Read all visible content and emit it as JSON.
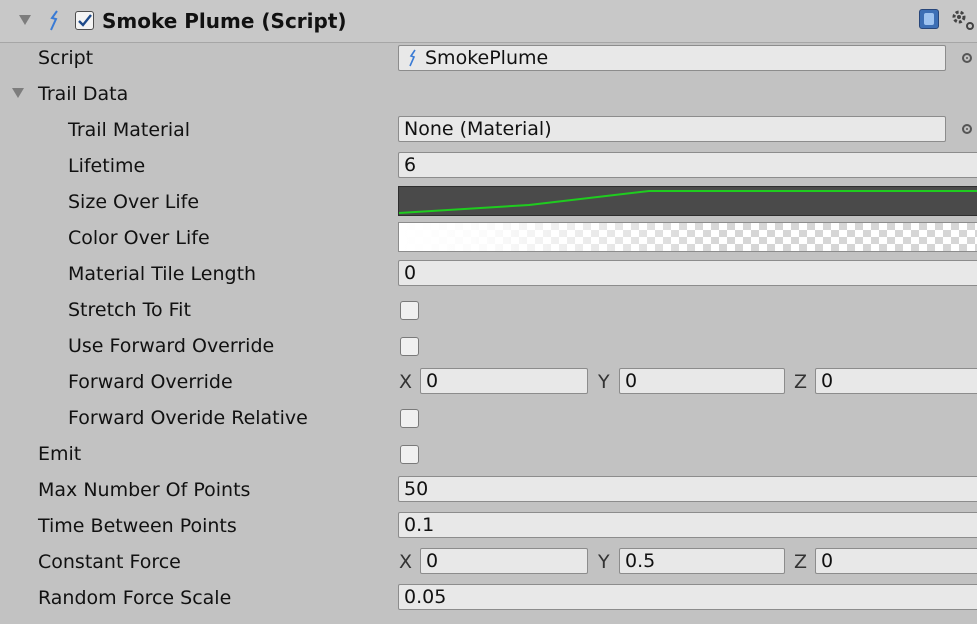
{
  "component": {
    "title": "Smoke Plume (Script)",
    "enabled": true,
    "icons": [
      "script-icon",
      "help-icon",
      "gear-icon"
    ]
  },
  "script": {
    "label": "Script",
    "value": "SmokePlume"
  },
  "trail_data": {
    "label": "Trail Data",
    "trail_material": {
      "label": "Trail Material",
      "value": "None (Material)"
    },
    "lifetime": {
      "label": "Lifetime",
      "value": "6"
    },
    "size_over_life": {
      "label": "Size Over Life"
    },
    "color_over_life": {
      "label": "Color Over Life"
    },
    "material_tile_length": {
      "label": "Material Tile Length",
      "value": "0"
    },
    "stretch_to_fit": {
      "label": "Stretch To Fit",
      "checked": false
    },
    "use_forward_override": {
      "label": "Use Forward Override",
      "checked": false
    },
    "forward_override": {
      "label": "Forward Override",
      "x": "0",
      "y": "0",
      "z": "0"
    },
    "forward_overide_relative": {
      "label": "Forward Overide Relative",
      "checked": false
    }
  },
  "emit": {
    "label": "Emit",
    "checked": false
  },
  "max_number_of_points": {
    "label": "Max Number Of Points",
    "value": "50"
  },
  "time_between_points": {
    "label": "Time Between Points",
    "value": "0.1"
  },
  "constant_force": {
    "label": "Constant Force",
    "x": "0",
    "y": "0.5",
    "z": "0"
  },
  "random_force_scale": {
    "label": "Random Force Scale",
    "value": "0.05"
  },
  "axis_labels": {
    "x": "X",
    "y": "Y",
    "z": "Z"
  },
  "colors": {
    "panel_bg": "#c2c2c2",
    "field_bg": "#e8e8e8",
    "curve_bg": "#4a4a4a",
    "curve_line": "#1fcc1f",
    "checkmark": "#1e4a8a"
  }
}
